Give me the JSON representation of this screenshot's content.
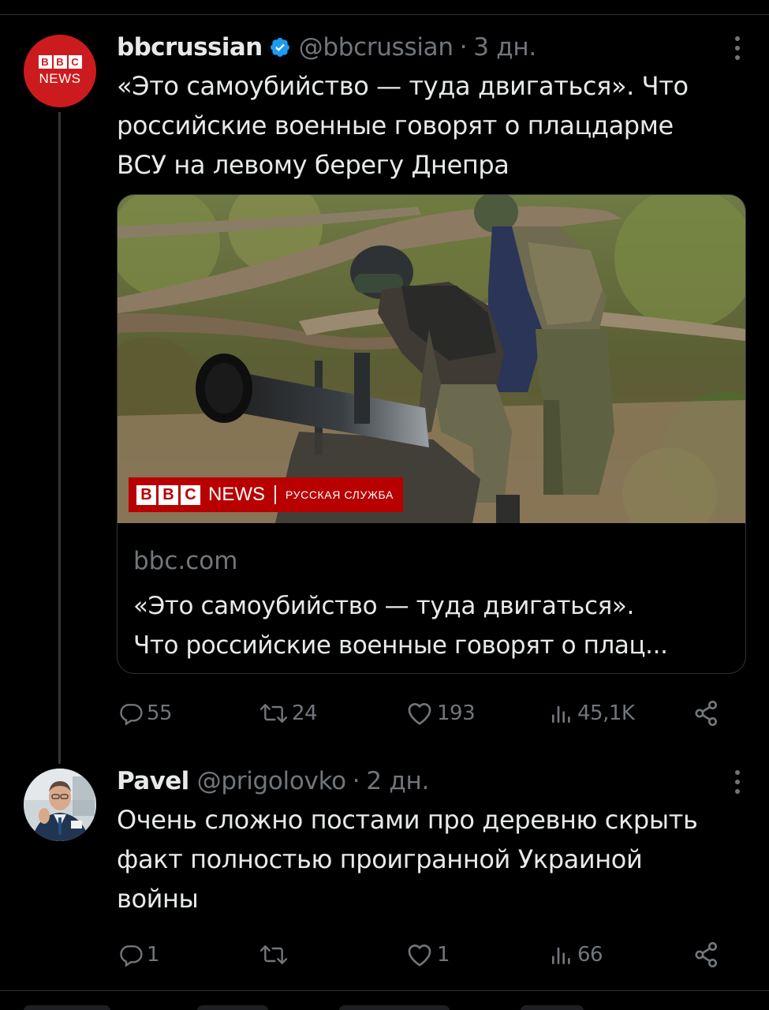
{
  "thread": [
    {
      "avatar": {
        "type": "bbc-news",
        "blocks": [
          "B",
          "B",
          "C"
        ],
        "text": "NEWS"
      },
      "author_name": "bbcrussian",
      "verified": true,
      "handle": "@bbcrussian",
      "separator": "·",
      "time": "3 дн.",
      "text_lines": [
        "«Это самоубийство — туда двигаться». Что",
        "российские военные говорят о плацдарме",
        "ВСУ на левому берегу Днепра"
      ],
      "card": {
        "image_banner": {
          "blocks": [
            "B",
            "B",
            "C"
          ],
          "news": "NEWS",
          "divider": "|",
          "service": "РУССКАЯ СЛУЖБА"
        },
        "domain": "bbc.com",
        "title_lines": [
          "«Это самоубийство — туда двигаться».",
          "Что российские военные говорят о плац..."
        ]
      },
      "stats": {
        "replies": "55",
        "reposts": "24",
        "likes": "193",
        "views": "45,1K"
      }
    },
    {
      "avatar": {
        "type": "photo"
      },
      "author_name": "Pavel",
      "verified": false,
      "handle": "@prigolovko",
      "separator": "·",
      "time": "2 дн.",
      "text_lines": [
        "Очень сложно постами про деревню скрыть",
        "факт полностью проигранной Украиной",
        "войны"
      ],
      "stats": {
        "replies": "1",
        "reposts": "",
        "likes": "1",
        "views": "66"
      }
    }
  ],
  "icons": {
    "verified": "verified-badge-icon",
    "more": "more-options-icon",
    "reply": "reply-icon",
    "repost": "repost-icon",
    "like": "heart-icon",
    "views": "views-chart-icon",
    "share": "share-icon"
  },
  "colors": {
    "background": "#000000",
    "text": "#e7e9ea",
    "muted": "#71767b",
    "verified": "#1d9bf0",
    "bbc_red": "#cc1b1f",
    "divider": "#2f3336"
  }
}
